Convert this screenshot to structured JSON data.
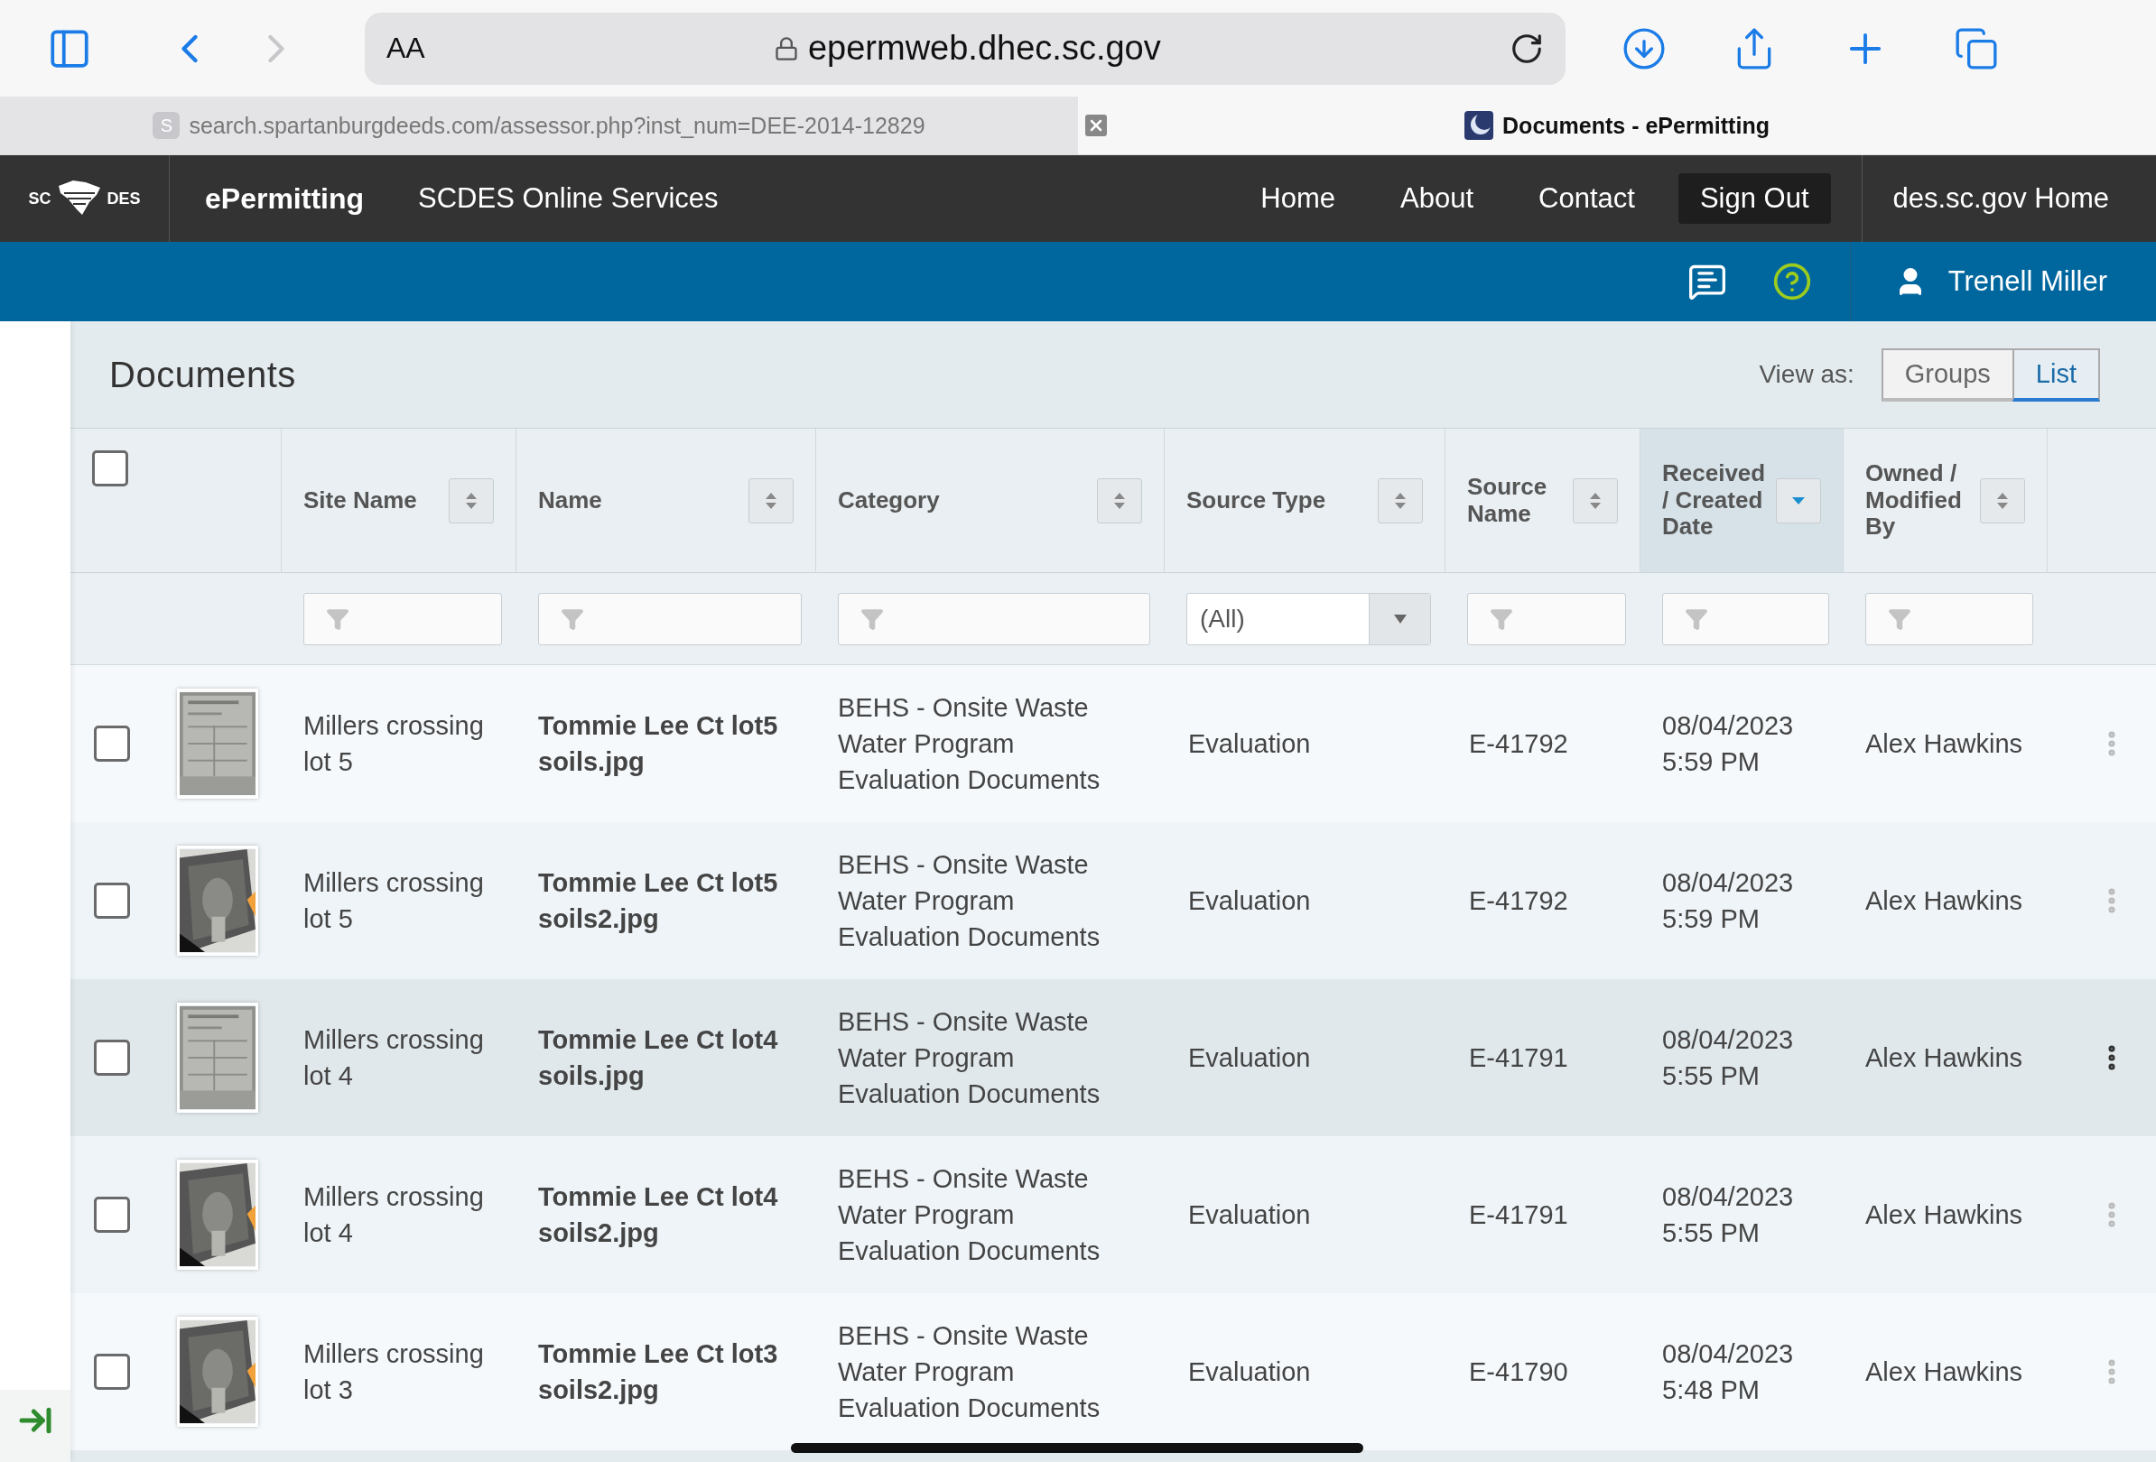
{
  "browser": {
    "text_size": "AA",
    "address": "epermweb.dhec.sc.gov",
    "tabs": [
      {
        "favicon": "S",
        "title": "search.spartanburgdeeds.com/assessor.php?inst_num=DEE-2014-12829",
        "selected": false
      },
      {
        "title": "Documents - ePermitting",
        "selected": true
      }
    ]
  },
  "nav": {
    "logo_left": "SC",
    "logo_right": "DES",
    "app_name": "ePermitting",
    "subtitle": "SCDES Online Services",
    "links": [
      {
        "label": "Home",
        "kind": "link"
      },
      {
        "label": "About",
        "kind": "link"
      },
      {
        "label": "Contact",
        "kind": "link"
      },
      {
        "label": "Sign Out",
        "kind": "button"
      }
    ],
    "external_link": "des.sc.gov Home"
  },
  "user": {
    "name": "Trenell Miller"
  },
  "documents": {
    "title": "Documents",
    "view_as_label": "View as:",
    "view_options": [
      {
        "label": "Groups",
        "selected": false
      },
      {
        "label": "List",
        "selected": true
      }
    ],
    "select_all": {
      "checked": false
    },
    "columns": [
      {
        "label": "Site Name",
        "sorted": false
      },
      {
        "label": "Name",
        "sorted": false
      },
      {
        "label": "Category",
        "sorted": false
      },
      {
        "label": "Source Type",
        "sorted": false
      },
      {
        "label": "Source Name",
        "sorted": false
      },
      {
        "label": "Received / Created Date",
        "sorted": true
      },
      {
        "label": "Owned / Modified By",
        "sorted": false
      }
    ],
    "filters": [
      {
        "kind": "text"
      },
      {
        "kind": "text"
      },
      {
        "kind": "text"
      },
      {
        "kind": "select",
        "value": "(All)"
      },
      {
        "kind": "text"
      },
      {
        "kind": "text"
      },
      {
        "kind": "text"
      }
    ],
    "rows": [
      {
        "checked": false,
        "hovered": false,
        "site": "Millers crossing lot 5",
        "name": "Tommie Lee Ct lot5 soils.jpg",
        "category": "BEHS - Onsite Waste Water Program Evaluation Documents",
        "source_type": "Evaluation",
        "source_name": "E-41792",
        "date": "08/04/2023 5:59 PM",
        "owner": "Alex Hawkins"
      },
      {
        "checked": false,
        "hovered": false,
        "site": "Millers crossing lot 5",
        "name": "Tommie Lee Ct lot5 soils2.jpg",
        "category": "BEHS - Onsite Waste Water Program Evaluation Documents",
        "source_type": "Evaluation",
        "source_name": "E-41792",
        "date": "08/04/2023 5:59 PM",
        "owner": "Alex Hawkins"
      },
      {
        "checked": false,
        "hovered": true,
        "site": "Millers crossing lot 4",
        "name": "Tommie Lee Ct lot4 soils.jpg",
        "category": "BEHS - Onsite Waste Water Program Evaluation Documents",
        "source_type": "Evaluation",
        "source_name": "E-41791",
        "date": "08/04/2023 5:55 PM",
        "owner": "Alex Hawkins"
      },
      {
        "checked": false,
        "hovered": false,
        "site": "Millers crossing lot 4",
        "name": "Tommie Lee Ct lot4 soils2.jpg",
        "category": "BEHS - Onsite Waste Water Program Evaluation Documents",
        "source_type": "Evaluation",
        "source_name": "E-41791",
        "date": "08/04/2023 5:55 PM",
        "owner": "Alex Hawkins"
      },
      {
        "checked": false,
        "hovered": false,
        "site": "Millers crossing lot 3",
        "name": "Tommie Lee Ct lot3 soils2.jpg",
        "category": "BEHS - Onsite Waste Water Program Evaluation Documents",
        "source_type": "Evaluation",
        "source_name": "E-41790",
        "date": "08/04/2023 5:48 PM",
        "owner": "Alex Hawkins"
      }
    ]
  }
}
